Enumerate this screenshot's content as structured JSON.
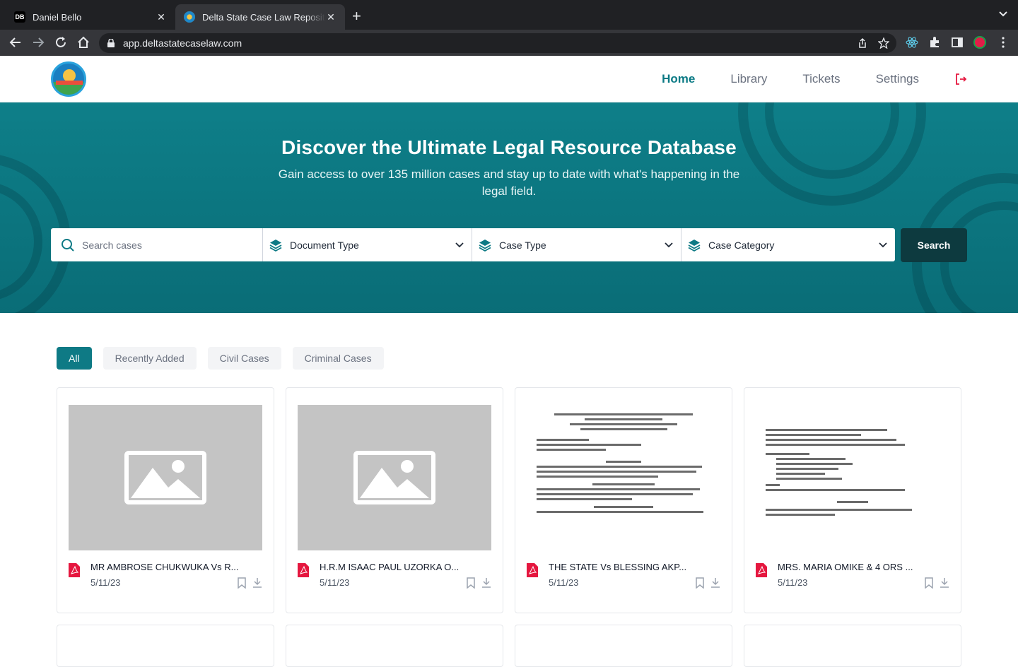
{
  "browser": {
    "tabs": [
      {
        "favicon": "DB",
        "title": "Daniel Bello"
      },
      {
        "favicon": "delta-logo",
        "title": "Delta State Case Law Repository"
      }
    ],
    "url": "app.deltastatecaselaw.com"
  },
  "nav": {
    "items": [
      "Home",
      "Library",
      "Tickets",
      "Settings"
    ],
    "active": "Home"
  },
  "hero": {
    "title": "Discover the Ultimate Legal Resource Database",
    "subtitle": "Gain access to over 135 million cases and stay up to date with what's happening in the legal field."
  },
  "search": {
    "placeholder": "Search cases",
    "document_type": "Document Type",
    "case_type": "Case Type",
    "case_category": "Case Category",
    "button": "Search"
  },
  "filters": [
    "All",
    "Recently Added",
    "Civil Cases",
    "Criminal Cases"
  ],
  "cards": [
    {
      "title": "MR AMBROSE CHUKWUKA Vs R...",
      "date": "5/11/23",
      "thumb": "placeholder"
    },
    {
      "title": "H.R.M ISAAC PAUL UZORKA O...",
      "date": "5/11/23",
      "thumb": "placeholder"
    },
    {
      "title": "THE STATE Vs BLESSING AKP...",
      "date": "5/11/23",
      "thumb": "document"
    },
    {
      "title": "MRS. MARIA OMIKE & 4 ORS ...",
      "date": "5/11/23",
      "thumb": "document"
    }
  ],
  "colors": {
    "primary": "#0e7a85",
    "dark": "#0d3a3f",
    "pdf": "#e5173f"
  }
}
